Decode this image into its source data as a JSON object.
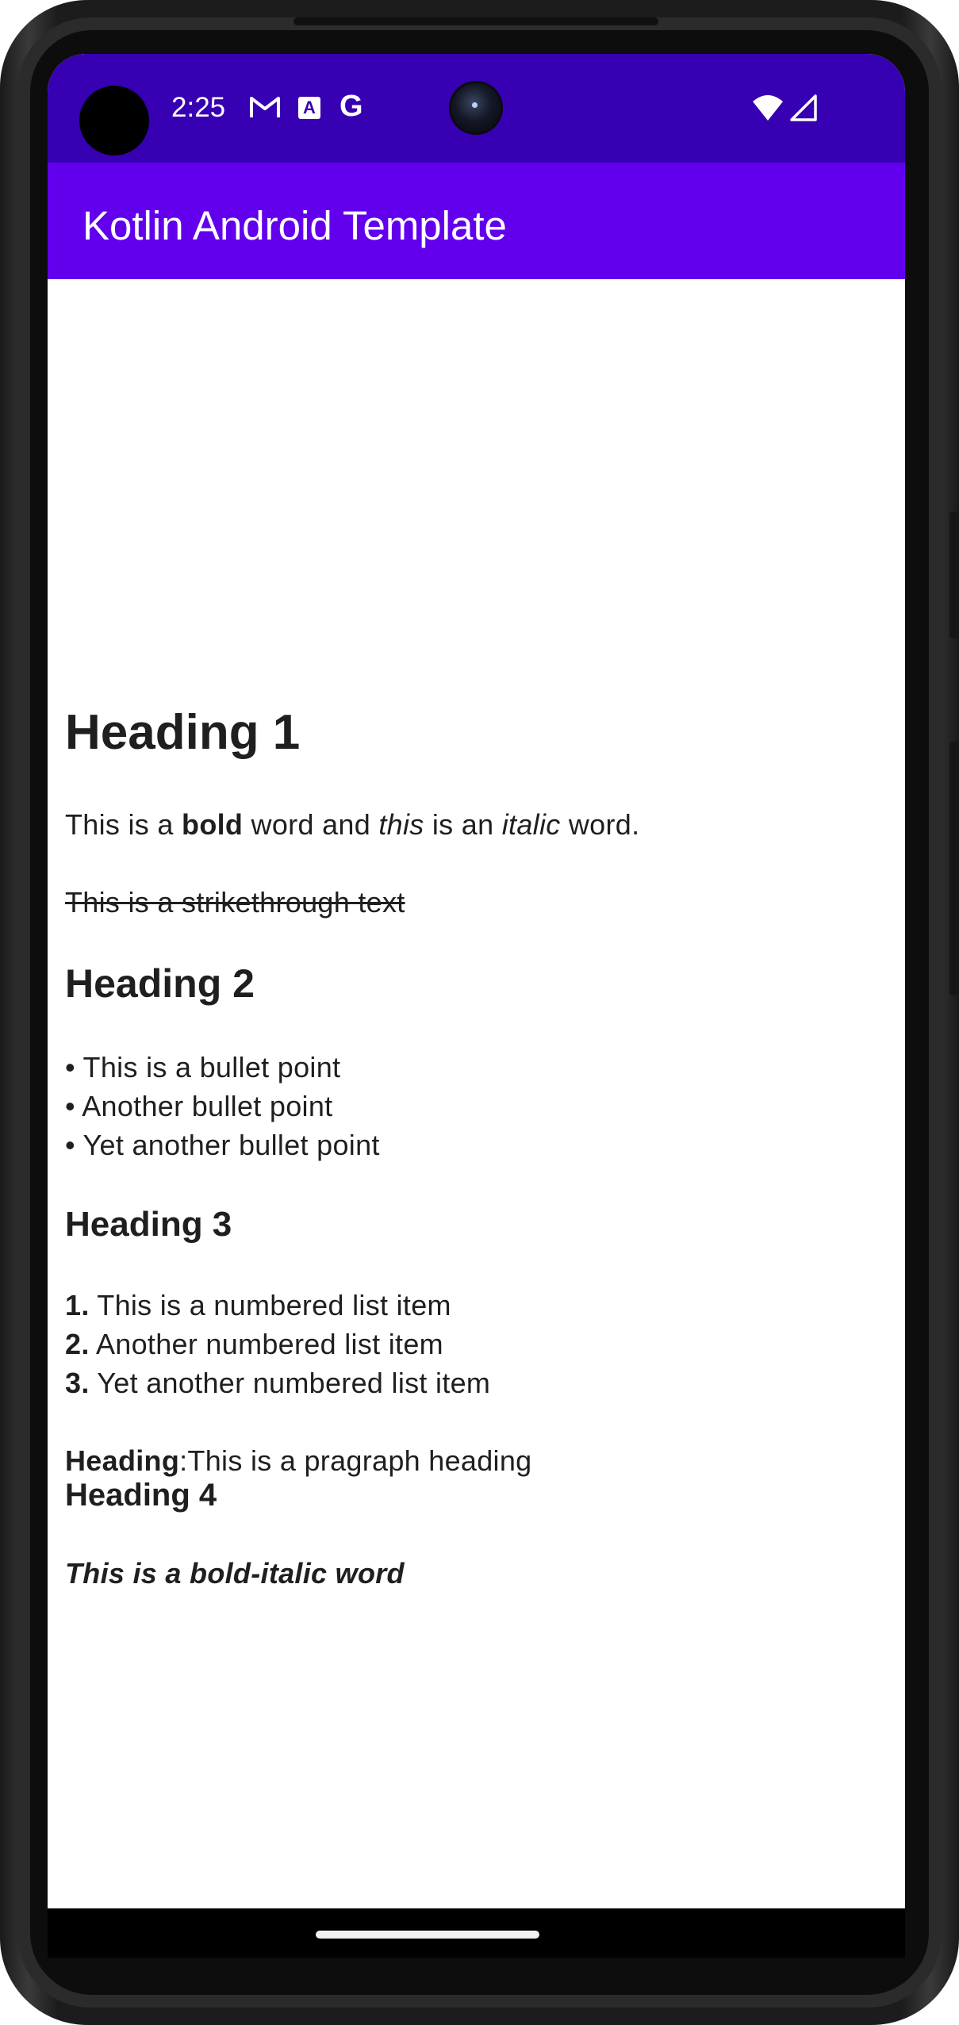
{
  "status_bar": {
    "time": "2:25",
    "icons": [
      "gmail-icon",
      "accessibility-a-icon",
      "google-g-icon",
      "wifi-icon",
      "cellular-signal-icon"
    ],
    "a_glyph": "A",
    "g_glyph": "G"
  },
  "app_bar": {
    "title": "Kotlin Android Template"
  },
  "colors": {
    "status_bar": "#3700b3",
    "app_bar": "#6200ee",
    "text": "#1f1f1f"
  },
  "content": {
    "heading1": "Heading 1",
    "paragraph": {
      "t1": "This is a ",
      "bold": "bold",
      "t2": " word and ",
      "italic1": "this",
      "t3": " is an ",
      "italic2": "italic",
      "t4": " word."
    },
    "strikethrough": "This is a strikethrough text",
    "heading2": "Heading 2",
    "bullets": [
      "• This is a bullet point",
      "• Another bullet point",
      "• Yet another bullet point"
    ],
    "heading3": "Heading 3",
    "numbered": [
      {
        "num": "1.",
        "text": " This is a numbered list item"
      },
      {
        "num": "2.",
        "text": " Another numbered list item"
      },
      {
        "num": "3.",
        "text": " Yet another numbered list item"
      }
    ],
    "paragraph_heading": {
      "label": "Heading",
      "text": ":This is a pragraph heading"
    },
    "heading4": "Heading 4",
    "bold_italic": "This is a bold-italic word"
  }
}
